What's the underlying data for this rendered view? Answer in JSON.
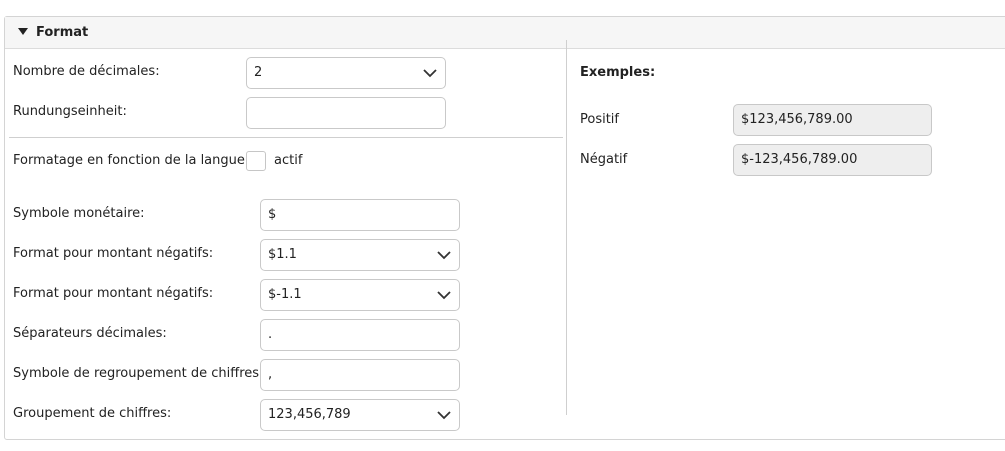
{
  "section": {
    "title": "Format"
  },
  "fields": {
    "decimals": {
      "label": "Nombre de décimales:",
      "value": "2"
    },
    "rounding": {
      "label": "Rundungseinheit:",
      "value": ""
    },
    "locale": {
      "label": "Formatage en fonction de la langue:",
      "checkbox_label": "actif",
      "checked": false
    },
    "currency_symbol": {
      "label": "Symbole monétaire:",
      "value": "$"
    },
    "positive_format": {
      "label": "Format pour montant négatifs:",
      "value": "$1.1"
    },
    "negative_format": {
      "label": "Format pour montant négatifs:",
      "value": "$-1.1"
    },
    "decimal_separator": {
      "label": "Séparateurs décimales:",
      "value": "."
    },
    "grouping_symbol": {
      "label": "Symbole de regroupement de chiffres:",
      "value": ","
    },
    "digit_grouping": {
      "label": "Groupement de chiffres:",
      "value": "123,456,789"
    }
  },
  "examples": {
    "title": "Exemples:",
    "positive": {
      "label": "Positif",
      "value": "$123,456,789.00"
    },
    "negative": {
      "label": "Négatif",
      "value": "$-123,456,789.00"
    }
  }
}
